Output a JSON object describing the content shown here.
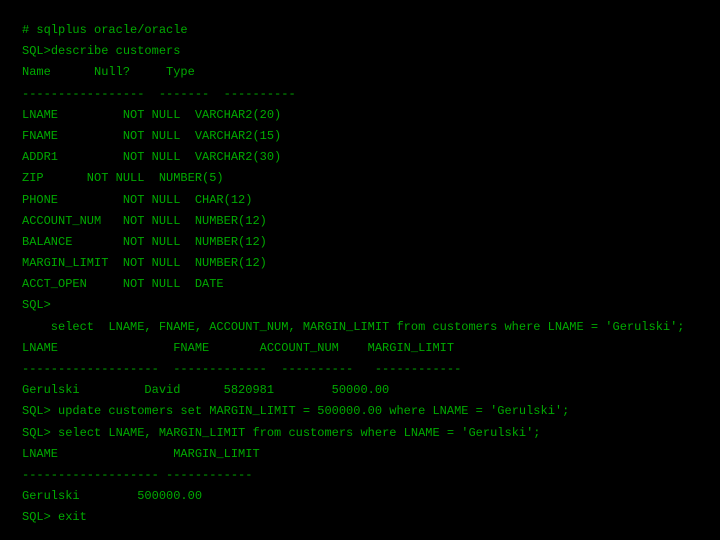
{
  "shell": "# sqlplus oracle/oracle",
  "prompt": "SQL>",
  "cmd1": "describe customers",
  "desc": {
    "header": "Name      Null?     Type",
    "rule": "-----------------  -------  ----------",
    "rows": [
      "LNAME         NOT NULL  VARCHAR2(20)",
      "FNAME         NOT NULL  VARCHAR2(15)",
      "ADDR1         NOT NULL  VARCHAR2(30)",
      "ZIP      NOT NULL  NUMBER(5)",
      "PHONE         NOT NULL  CHAR(12)",
      "ACCOUNT_NUM   NOT NULL  NUMBER(12)",
      "BALANCE       NOT NULL  NUMBER(12)",
      "MARGIN_LIMIT  NOT NULL  NUMBER(12)",
      "ACCT_OPEN     NOT NULL  DATE"
    ]
  },
  "cmd2": "    select  LNAME, FNAME, ACCOUNT_NUM, MARGIN_LIMIT from customers where LNAME = 'Gerulski';",
  "q1": {
    "header": "LNAME                FNAME       ACCOUNT_NUM    MARGIN_LIMIT",
    "rule": "-------------------  -------------  ----------   ------------",
    "row": "Gerulski         David      5820981        50000.00"
  },
  "cmd3": " update customers set MARGIN_LIMIT = 500000.00 where LNAME = 'Gerulski';",
  "cmd4": " select LNAME, MARGIN_LIMIT from customers where LNAME = 'Gerulski';",
  "q2": {
    "header": "LNAME                MARGIN_LIMIT",
    "rule": "------------------- ------------",
    "row": "Gerulski        500000.00"
  },
  "cmd5": " exit"
}
